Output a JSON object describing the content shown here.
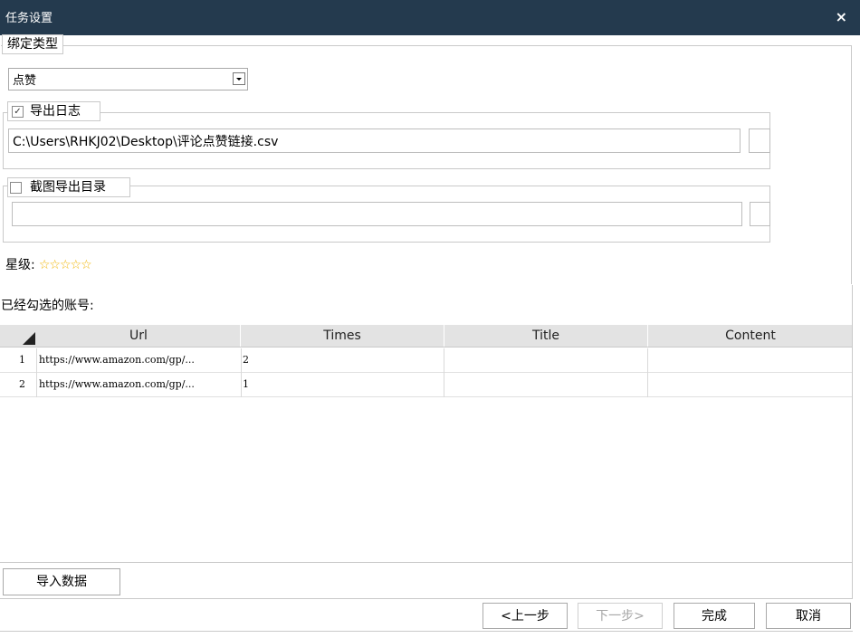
{
  "window": {
    "title": "任务设置",
    "close_icon": "×"
  },
  "bind_type": {
    "legend": "绑定类型",
    "selected": "点赞"
  },
  "export_log": {
    "checked": true,
    "label": "导出日志",
    "path": "C:\\Users\\RHKJ02\\Desktop\\评论点赞链接.csv"
  },
  "screenshot_dir": {
    "checked": false,
    "label": "截图导出目录",
    "path": ""
  },
  "rating": {
    "label": "星级:",
    "stars": "☆☆☆☆☆",
    "value": 0,
    "max": 5
  },
  "accounts": {
    "label": "已经勾选的账号:"
  },
  "table": {
    "columns": [
      "Url",
      "Times",
      "Title",
      "Content"
    ],
    "rows": [
      {
        "index": "1",
        "url": "https://www.amazon.com/gp/...",
        "times": "2",
        "title": "",
        "content": ""
      },
      {
        "index": "2",
        "url": "https://www.amazon.com/gp/...",
        "times": "1",
        "title": "",
        "content": ""
      }
    ]
  },
  "buttons": {
    "import": "导入数据",
    "prev": "<上一步",
    "next": "下一步>",
    "finish": "完成",
    "cancel": "取消"
  }
}
